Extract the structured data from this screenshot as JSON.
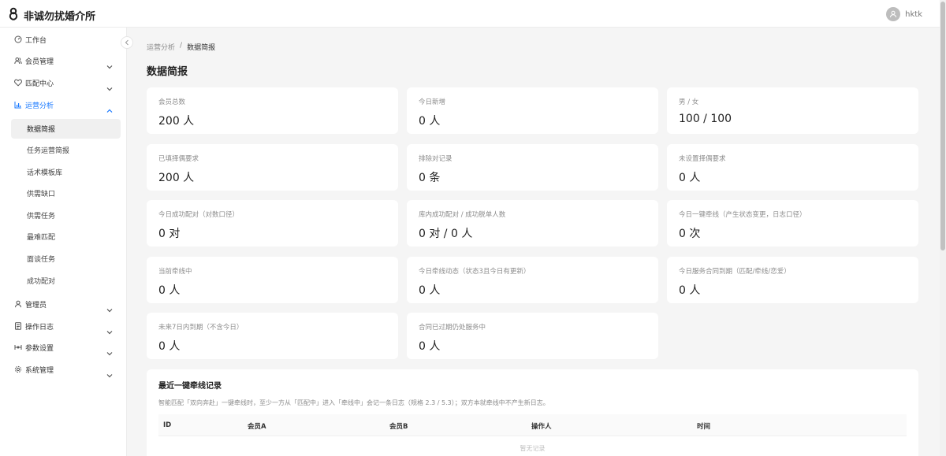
{
  "app": {
    "title": "非诚勿扰婚介所"
  },
  "user": {
    "name": "hktk"
  },
  "sidebar": {
    "items": [
      {
        "label": "工作台",
        "icon": "dashboard-icon",
        "has_children": false
      },
      {
        "label": "会员管理",
        "icon": "members-icon",
        "has_children": true
      },
      {
        "label": "匹配中心",
        "icon": "heart-icon",
        "has_children": true
      },
      {
        "label": "运营分析",
        "icon": "bar-chart-icon",
        "has_children": true,
        "open": true
      },
      {
        "label": "管理员",
        "icon": "user-icon",
        "has_children": true
      },
      {
        "label": "操作日志",
        "icon": "log-icon",
        "has_children": true
      },
      {
        "label": "参数设置",
        "icon": "sliders-icon",
        "has_children": true
      },
      {
        "label": "系统管理",
        "icon": "gear-icon",
        "has_children": true
      }
    ],
    "sub_items": [
      "数据简报",
      "任务运营简报",
      "话术模板库",
      "供需缺口",
      "供需任务",
      "最难匹配",
      "面谈任务",
      "成功配对"
    ],
    "active_sub": "数据简报"
  },
  "breadcrumb": {
    "parent": "运营分析",
    "separator": "/",
    "current": "数据简报"
  },
  "page": {
    "title": "数据简报"
  },
  "cards": [
    {
      "label": "会员总数",
      "value": "200 人"
    },
    {
      "label": "今日新增",
      "value": "0 人"
    },
    {
      "label": "男 / 女",
      "value": "100 / 100"
    },
    {
      "label": "已填择偶要求",
      "value": "200 人"
    },
    {
      "label": "排除对记录",
      "value": "0 条"
    },
    {
      "label": "未设置择偶要求",
      "value": "0 人"
    },
    {
      "label": "今日成功配对（对数口径）",
      "value": "0 对"
    },
    {
      "label": "库内成功配对 / 成功脱单人数",
      "value": "0 对 / 0 人"
    },
    {
      "label": "今日一键牵线（产生状态变更，日志口径）",
      "value": "0 次"
    },
    {
      "label": "当前牵线中",
      "value": "0 人"
    },
    {
      "label": "今日牵线动态（状态3且今日有更新）",
      "value": "0 人"
    },
    {
      "label": "今日服务合同到期（匹配/牵线/恋爱）",
      "value": "0 人"
    },
    {
      "label": "未来7日内到期（不含今日）",
      "value": "0 人"
    },
    {
      "label": "合同已过期仍处服务中",
      "value": "0 人"
    }
  ],
  "recent": {
    "title": "最近一键牵线记录",
    "description": "智能匹配「双向奔赴」一键牵线时，至少一方从「匹配中」进入「牵线中」会记一条日志（规格 2.3 / 5.3）；双方本就牵线中不产生新日志。",
    "columns": [
      "ID",
      "会员A",
      "会员B",
      "操作人",
      "时间"
    ],
    "empty_text": "暂无记录"
  },
  "colors": {
    "accent": "#1677ff",
    "background": "#f5f5f5",
    "card": "#ffffff"
  }
}
